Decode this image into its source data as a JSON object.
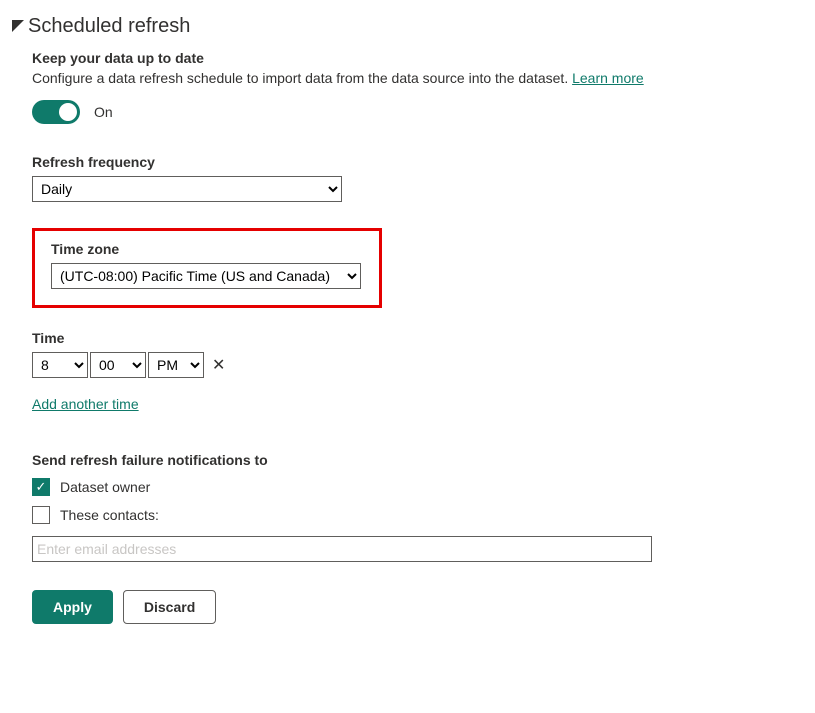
{
  "section": {
    "title": "Scheduled refresh"
  },
  "keep": {
    "title": "Keep your data up to date",
    "desc": "Configure a data refresh schedule to import data from the data source into the dataset. ",
    "learn_more": "Learn more"
  },
  "toggle": {
    "state_label": "On"
  },
  "frequency": {
    "label": "Refresh frequency",
    "value": "Daily"
  },
  "timezone": {
    "label": "Time zone",
    "value": "(UTC-08:00) Pacific Time (US and Canada)"
  },
  "time": {
    "label": "Time",
    "hour": "8",
    "minute": "00",
    "ampm": "PM",
    "remove_glyph": "✕"
  },
  "add_time": "Add another time",
  "notify": {
    "label": "Send refresh failure notifications to",
    "owner": {
      "label": "Dataset owner",
      "checked": true
    },
    "contacts": {
      "label": "These contacts:",
      "checked": false
    },
    "placeholder": "Enter email addresses"
  },
  "buttons": {
    "apply": "Apply",
    "discard": "Discard"
  }
}
